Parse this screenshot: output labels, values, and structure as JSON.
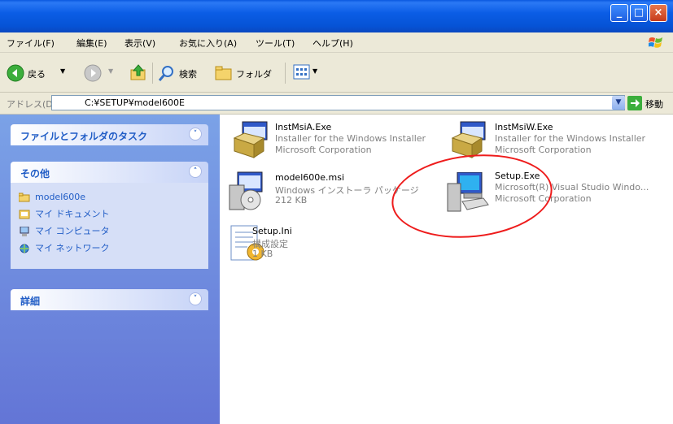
{
  "menu": [
    "ファイル(F)",
    "編集(E)",
    "表示(V)",
    "お気に入り(A)",
    "ツール(T)",
    "ヘルプ(H)"
  ],
  "toolbar": {
    "back_label": "戻る",
    "search_label": "検索",
    "folder_label": "フォルダ"
  },
  "address": {
    "label": "アドレス(D)",
    "path": "C:¥SETUP¥model600E",
    "go_label": "移動"
  },
  "sidebar": {
    "tasks_title": "ファイルとフォルダのタスク",
    "other_title": "その他",
    "other_items": [
      "model600e",
      "マイ ドキュメント",
      "マイ コンピュータ",
      "マイ ネットワーク"
    ],
    "details_title": "詳細"
  },
  "files": [
    {
      "name": "InstMsiA.Exe",
      "line2": "Installer for the Windows Installer",
      "line3": "Microsoft Corporation"
    },
    {
      "name": "InstMsiW.Exe",
      "line2": "Installer for the Windows Installer",
      "line3": "Microsoft Corporation"
    },
    {
      "name": "model600e.msi",
      "line2": "Windows インストーラ パッケージ",
      "line3": "212 KB"
    },
    {
      "name": "Setup.Exe",
      "line2": "Microsoft(R) Visual Studio Windo...",
      "line3": "Microsoft Corporation"
    },
    {
      "name": "Setup.Ini",
      "line2": "構成設定",
      "line3": "1 KB"
    }
  ],
  "icons": [
    "back-icon",
    "forward-icon",
    "up-folder-icon",
    "search-icon",
    "folders-icon",
    "views-icon",
    "go-arrow-icon",
    "windows-logo-icon",
    "minimize-icon",
    "maximize-icon",
    "close-icon"
  ]
}
